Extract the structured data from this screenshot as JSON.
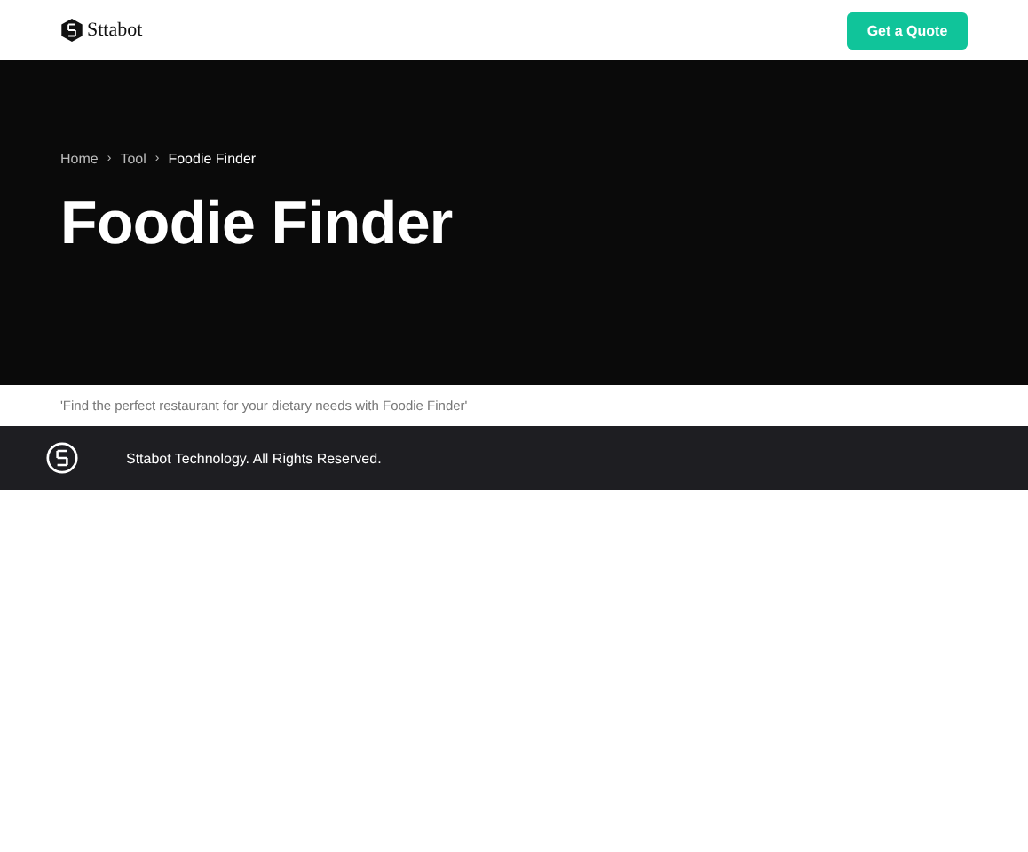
{
  "header": {
    "brand": "Sttabot",
    "cta": "Get a Quote"
  },
  "breadcrumb": {
    "separator": "›",
    "items": [
      {
        "label": "Home",
        "current": false
      },
      {
        "label": "Tool",
        "current": false
      },
      {
        "label": "Foodie Finder",
        "current": true
      }
    ]
  },
  "hero": {
    "title": "Foodie Finder"
  },
  "tagline": "'Find the perfect restaurant for your dietary needs with Foodie Finder'",
  "footer": {
    "copyright": "Sttabot Technology. All Rights Reserved."
  }
}
